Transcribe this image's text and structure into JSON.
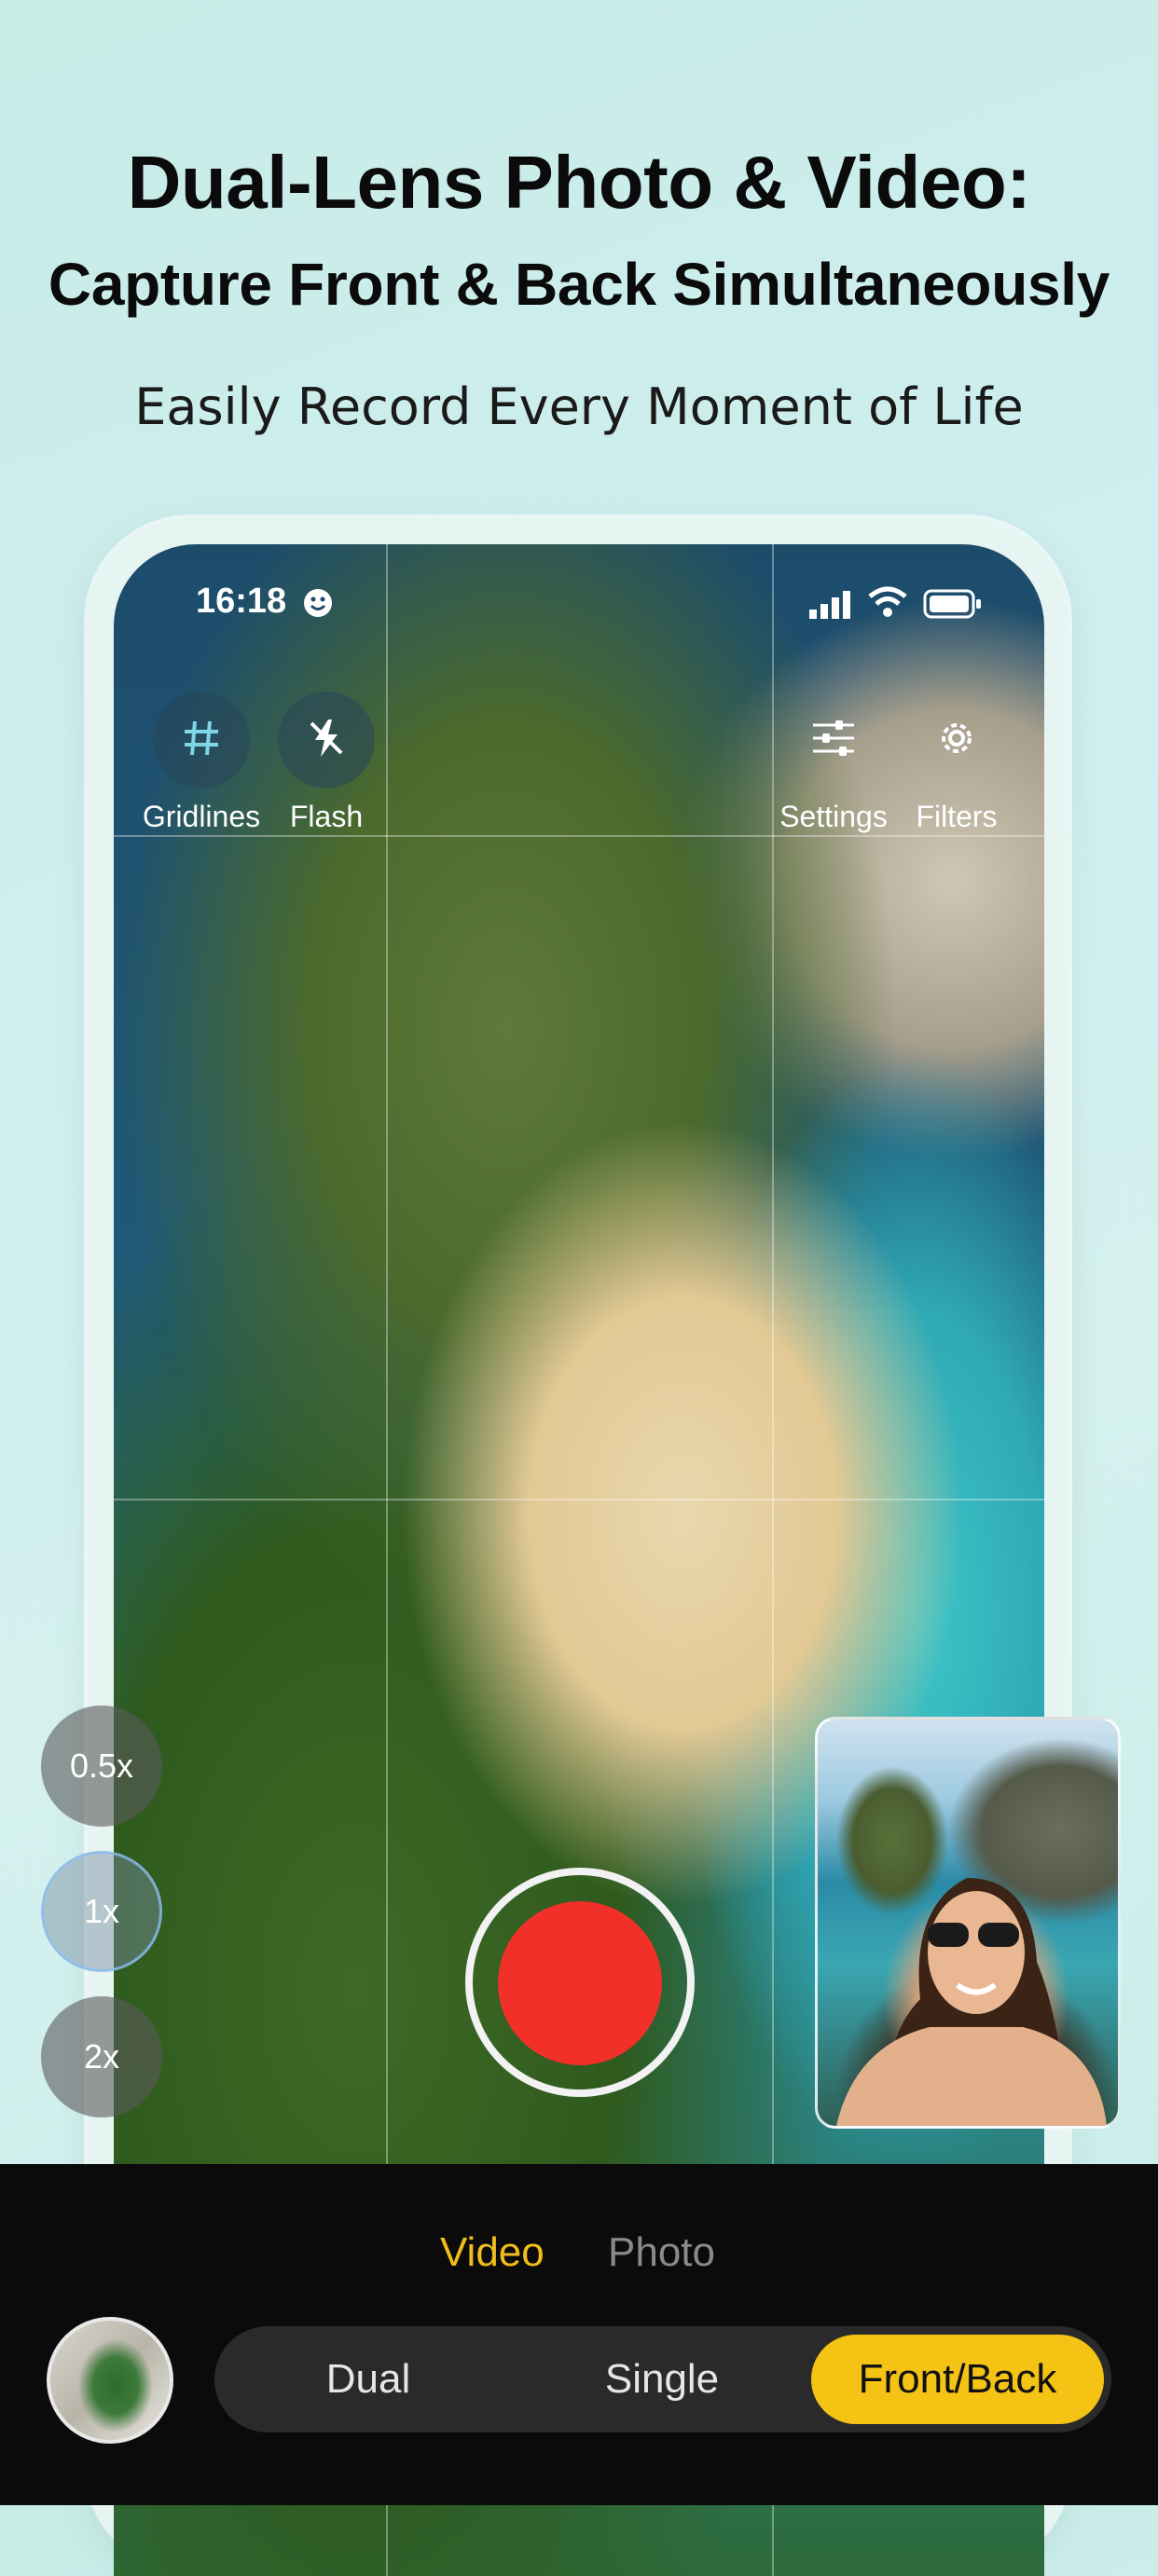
{
  "header": {
    "title_line1": "Dual-Lens Photo & Video:",
    "title_line2": "Capture Front & Back Simultaneously",
    "subtitle": "Easily Record Every Moment of Life"
  },
  "status_bar": {
    "time": "16:18"
  },
  "camera_controls": {
    "gridlines_label": "Gridlines",
    "flash_label": "Flash",
    "settings_label": "Settings",
    "filters_label": "Filters"
  },
  "zoom": {
    "options": [
      "0.5x",
      "1x",
      "2x"
    ],
    "selected": "1x"
  },
  "mode_tabs": {
    "video": "Video",
    "photo": "Photo",
    "selected": "Video"
  },
  "lens_modes": {
    "dual": "Dual",
    "single": "Single",
    "front_back": "Front/Back",
    "selected": "Front/Back"
  },
  "colors": {
    "accent_yellow": "#f4c314",
    "record_red": "#f2302a",
    "active_tab": "#f0bd1c"
  },
  "icons": [
    "smiley-icon",
    "signal-icon",
    "wifi-icon",
    "battery-icon",
    "grid-icon",
    "flash-off-icon",
    "sliders-icon",
    "gear-icon"
  ]
}
